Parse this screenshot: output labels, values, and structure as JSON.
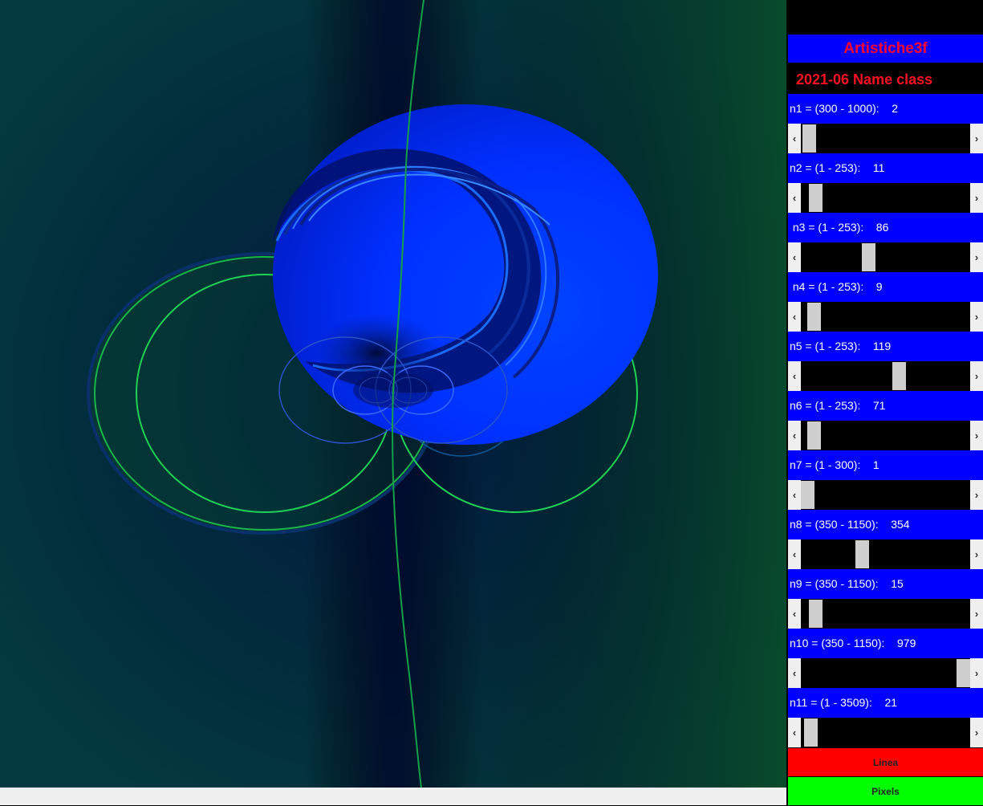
{
  "app": {
    "title": "Artistiche3f",
    "subtitle": "2021-06  Name class"
  },
  "params": [
    {
      "label": "n1 = (300 - 1000):",
      "value": "2",
      "fraction": 0.01
    },
    {
      "label": "n2 = (1 - 253):",
      "value": "11",
      "fraction": 0.05
    },
    {
      "label": " n3 = (1 - 253):",
      "value": "86",
      "fraction": 0.39
    },
    {
      "label": " n4 = (1 - 253):",
      "value": "9",
      "fraction": 0.04
    },
    {
      "label": "n5 = (1 - 253):",
      "value": "119",
      "fraction": 0.59
    },
    {
      "label": "n6 = (1 - 253):",
      "value": "71",
      "fraction": 0.04
    },
    {
      "label": "n7 = (1 - 300):",
      "value": "1",
      "fraction": 0.0
    },
    {
      "label": "n8 = (350 - 1150):",
      "value": "354",
      "fraction": 0.35
    },
    {
      "label": "n9 = (350 - 1150):",
      "value": "15",
      "fraction": 0.05
    },
    {
      "label": "n10 = (350 - 1150):",
      "value": "979",
      "fraction": 1.0
    },
    {
      "label": "n11 = (1 - 3509):",
      "value": "21",
      "fraction": 0.02
    }
  ],
  "buttons": {
    "linea": "Linea",
    "pixels": "Pixels"
  },
  "colors": {
    "panel_blue": "#0000ff",
    "title_red": "#ff0033",
    "linea_bg": "#ff0000",
    "pixels_bg": "#00ff00",
    "canvas_bg": "#043640"
  },
  "icons": {
    "scroll_left": "‹",
    "scroll_right": "›"
  }
}
